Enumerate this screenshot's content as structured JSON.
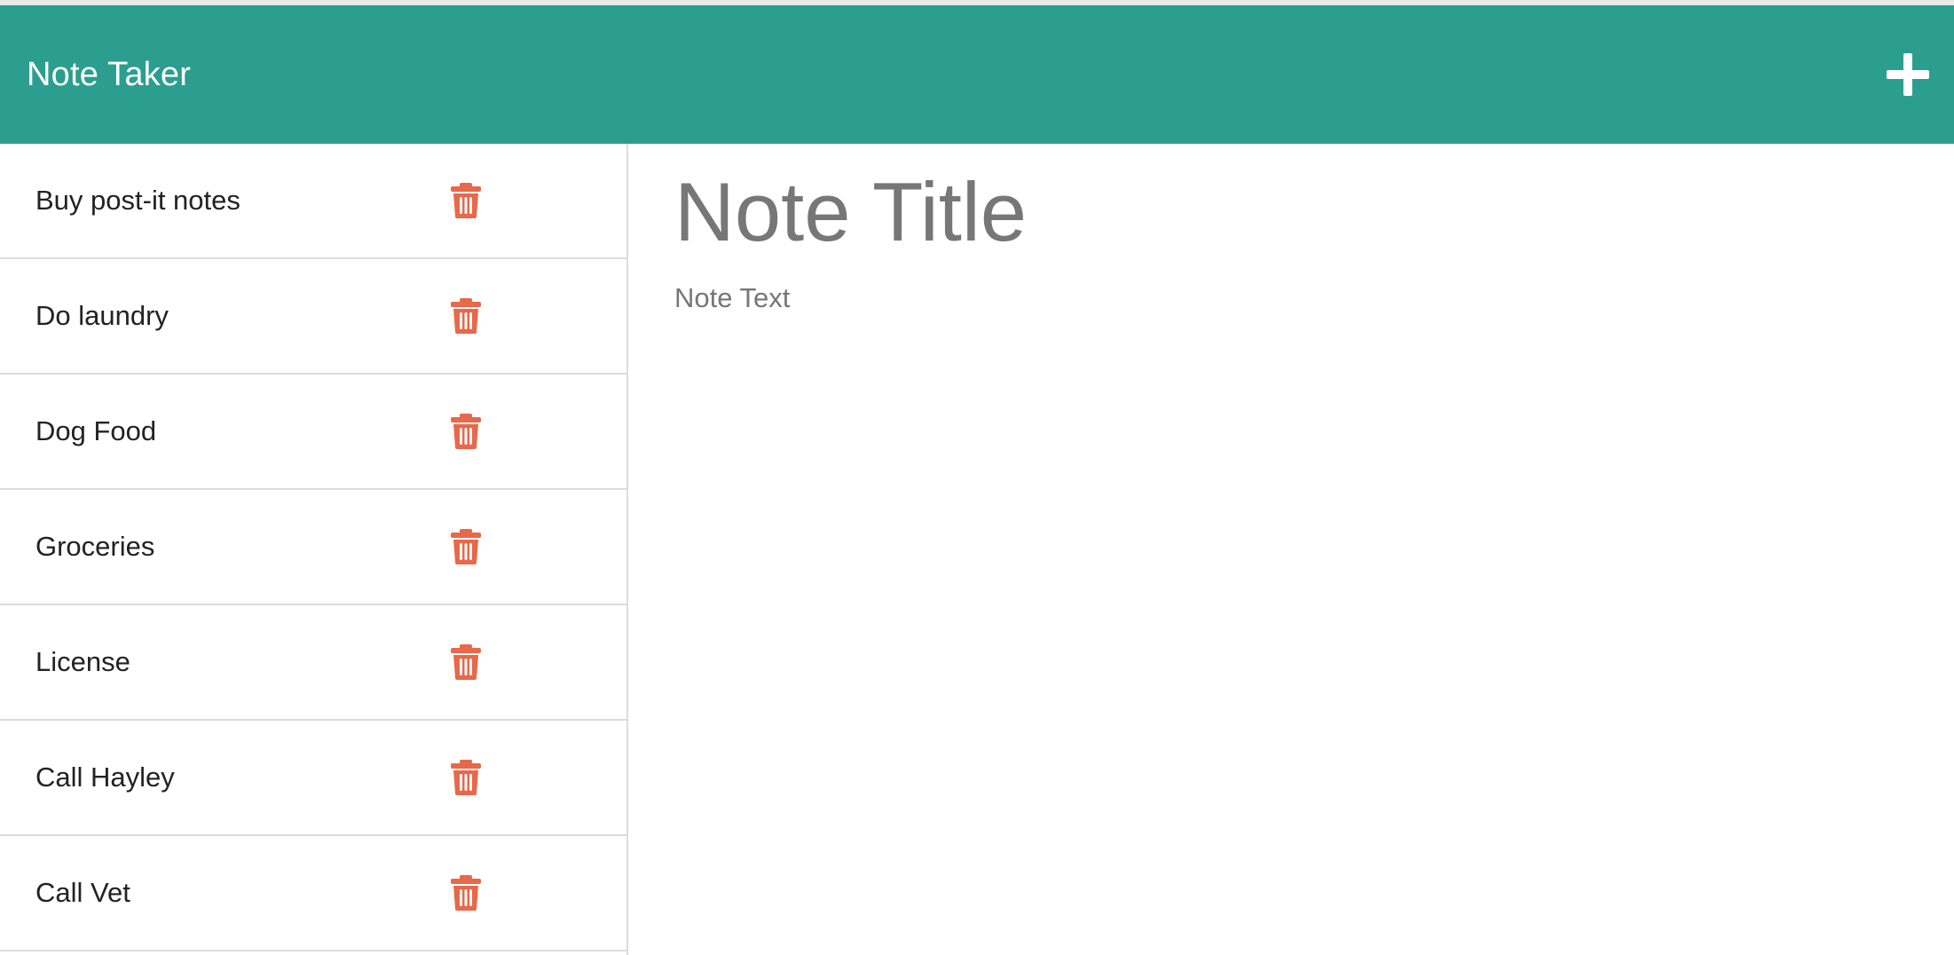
{
  "navbar": {
    "brand": "Note Taker",
    "new_note_icon": "plus-icon",
    "background_color": "#2b9e8f"
  },
  "notes": [
    {
      "title": "Buy post-it notes"
    },
    {
      "title": "Do laundry"
    },
    {
      "title": "Dog Food"
    },
    {
      "title": "Groceries"
    },
    {
      "title": "License"
    },
    {
      "title": "Call Hayley"
    },
    {
      "title": "Call Vet"
    }
  ],
  "delete_icon": "trash-icon",
  "delete_icon_color": "#e8684a",
  "editor": {
    "title_placeholder": "Note Title",
    "text_placeholder": "Note Text"
  }
}
